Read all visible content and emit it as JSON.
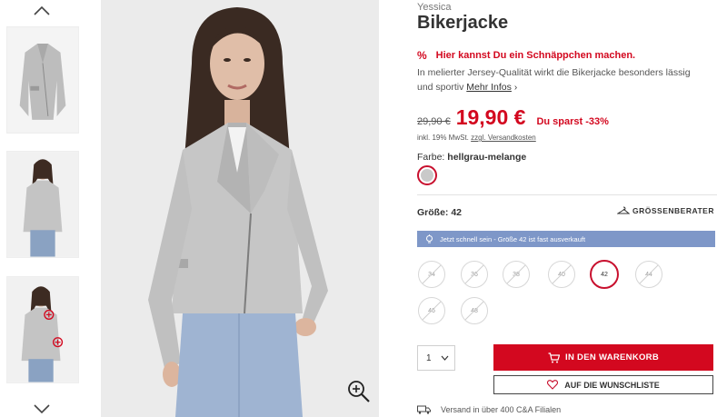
{
  "product": {
    "brand": "Yessica",
    "title": "Bikerjacke",
    "promo_icon": "%",
    "promo_text": "Hier kannst Du ein Schnäppchen machen.",
    "description": "In melierter Jersey-Qualität wirkt die Bikerjacke besonders lässig und sportiv",
    "more_info": "Mehr Infos",
    "old_price": "29,90 €",
    "price": "19,90 €",
    "saving": "Du sparst -33%",
    "vat_text": "inkl. 19% MwSt.",
    "shipping_link": "zzgl. Versandkosten",
    "color_label": "Farbe:",
    "color_value": "hellgrau-melange",
    "color_swatch": "#c9c9c9"
  },
  "sizes": {
    "label": "Größe: 42",
    "advisor": "GRÖSSENBERATER",
    "alert": "Jetzt schnell sein - Größe 42 ist fast ausverkauft",
    "options": [
      {
        "label": "34",
        "available": false
      },
      {
        "label": "36",
        "available": false
      },
      {
        "label": "38",
        "available": false
      },
      {
        "label": "40",
        "available": false
      },
      {
        "label": "42",
        "available": true,
        "selected": true
      },
      {
        "label": "44",
        "available": false
      },
      {
        "label": "46",
        "available": false
      },
      {
        "label": "48",
        "available": false
      }
    ]
  },
  "actions": {
    "quantity": "1",
    "add_to_cart": "IN DEN WARENKORB",
    "wishlist": "AUF DIE WUNSCHLISTE"
  },
  "delivery": {
    "text": "Versand in über 400 C&A Filialen"
  },
  "icons": {
    "up": "chevron-up-icon",
    "down": "chevron-down-icon",
    "zoom": "zoom-in-icon",
    "cart": "cart-icon",
    "heart": "heart-icon",
    "hanger": "hanger-icon",
    "bulb": "lightbulb-icon",
    "truck": "truck-icon"
  },
  "colors": {
    "accent": "#d3081f",
    "alert_bg": "#7e97c8"
  }
}
